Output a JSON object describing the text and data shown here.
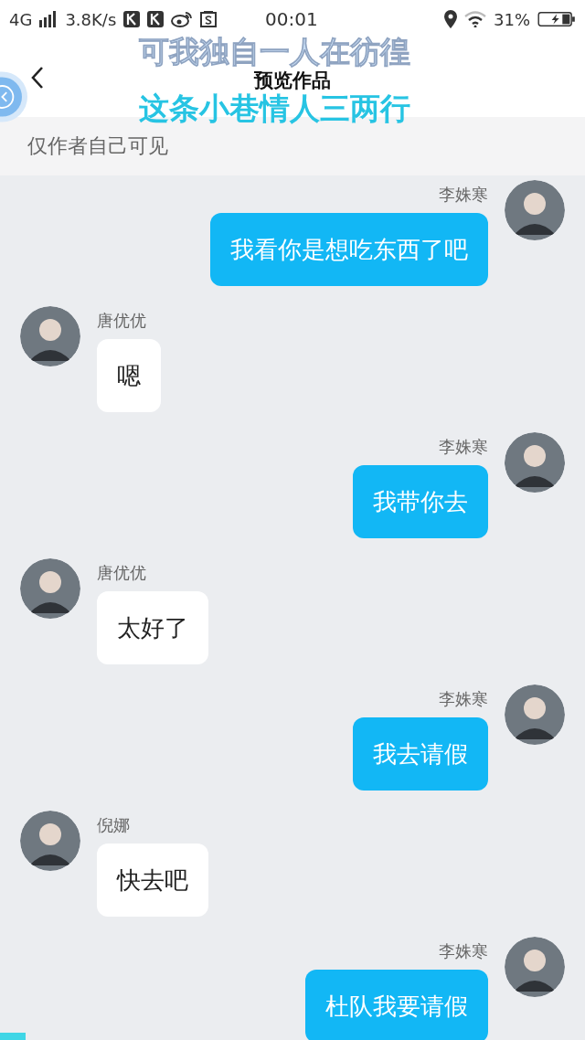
{
  "status_bar": {
    "network": "4G",
    "speed": "3.8K/s",
    "time": "00:01",
    "battery": "31%"
  },
  "header": {
    "title": "预览作品"
  },
  "lyrics": [
    {
      "text": "可我独自一人在彷徨",
      "selected": false
    },
    {
      "text": "这条小巷情人三两行",
      "selected": true
    }
  ],
  "notice": "仅作者自己可见",
  "messages": [
    {
      "kind": "right",
      "sender": "李姝寒",
      "text": "我看你是想吃东西了吧"
    },
    {
      "kind": "left",
      "sender": "唐优优",
      "text": "嗯"
    },
    {
      "kind": "right",
      "sender": "李姝寒",
      "text": "我带你去"
    },
    {
      "kind": "left",
      "sender": "唐优优",
      "text": "太好了"
    },
    {
      "kind": "right",
      "sender": "李姝寒",
      "text": "我去请假"
    },
    {
      "kind": "left",
      "sender": "倪娜",
      "text": "快去吧"
    },
    {
      "kind": "right",
      "sender": "李姝寒",
      "text": "杜队我要请假"
    }
  ]
}
